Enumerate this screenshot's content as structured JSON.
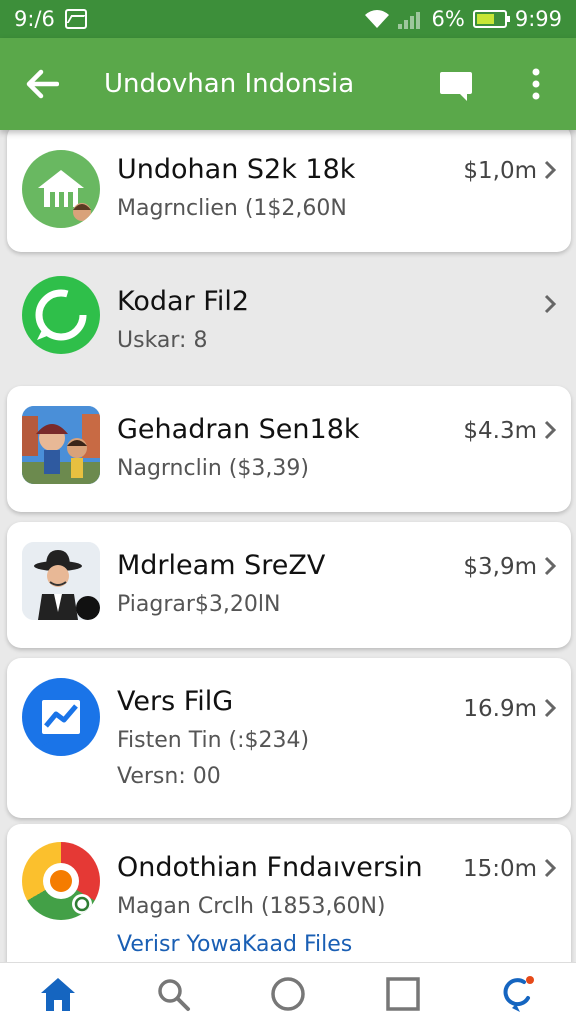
{
  "status_bar": {
    "time_left": "9:/6",
    "battery_percent": "6%",
    "time_right": "9:99",
    "battery_level": 0.65,
    "icons": [
      "image-icon",
      "wifi-icon",
      "signal-icon",
      "battery-icon"
    ]
  },
  "app_bar": {
    "title": "Undovhan Indonsia",
    "icons": [
      "back-arrow-icon",
      "chat-icon",
      "more-vertical-icon"
    ]
  },
  "colors": {
    "status_bar": "#3d8f3a",
    "app_bar": "#5aa84a",
    "background": "#e9e9e9",
    "link": "#1a5fb4",
    "nav_active": "#1565c0"
  },
  "items": [
    {
      "name": "Undohan S2k 18k",
      "sub": "Magrnclien (1$2,60N",
      "price": "$1,0m",
      "icon": "house-icon"
    },
    {
      "name": "Kodar Fil2",
      "sub": "Uskar: 8",
      "price": "",
      "icon": "whatsapp-icon"
    },
    {
      "name": "Gehadran Sen18k",
      "sub": "Nagrnclin ($3,39)",
      "price": "$4.3m",
      "icon": "game-characters-icon"
    },
    {
      "name": "Mdrleam SreZV",
      "sub": "Piagrar$3,20lN",
      "price": "$3,9m",
      "icon": "hat-character-icon"
    },
    {
      "name": "Vers FilG",
      "sub": "Fisten Tin (:$234)",
      "sub2": "Versn: 00",
      "price": "16.9m",
      "icon": "messenger-icon"
    },
    {
      "name": "Ondothian Fndaıversin",
      "sub": "Magan Crclh (1853,60N)",
      "link": "Verisr YowaKaad Files",
      "price": "15:0m",
      "icon": "chrome-icon"
    }
  ],
  "nav_bar": {
    "items": [
      "home-icon",
      "search-icon",
      "circle-icon",
      "square-icon",
      "sync-icon"
    ]
  }
}
